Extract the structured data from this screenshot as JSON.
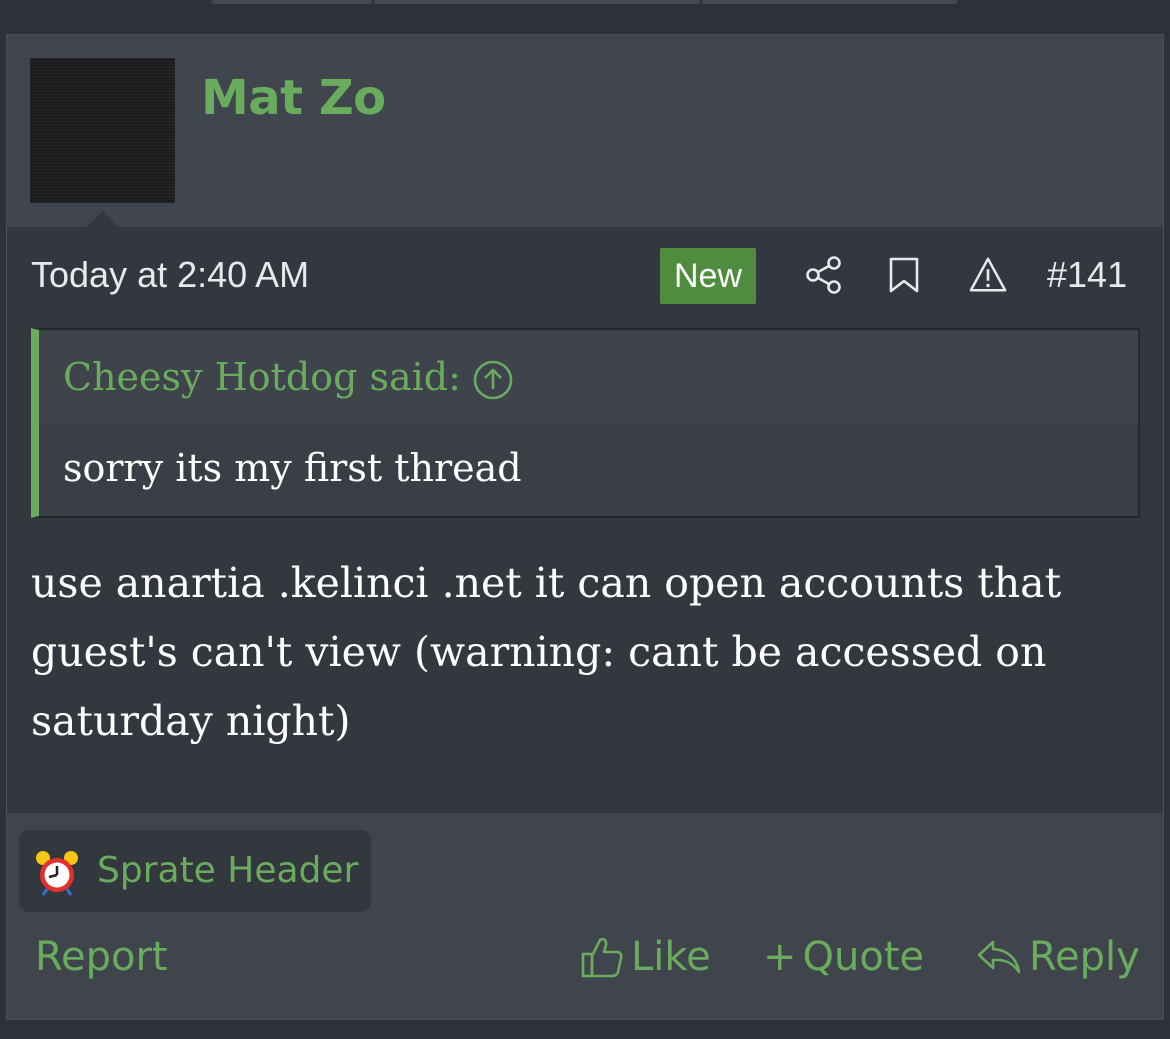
{
  "post": {
    "author": "Mat Zo",
    "timestamp": "Today at 2:40 AM",
    "badge": "New",
    "post_number": "#141",
    "icons": {
      "share": "share-icon",
      "bookmark": "bookmark-icon",
      "report": "warning-icon",
      "quote_jump": "arrow-up-circle-icon",
      "signature": "alarm-clock-icon",
      "like": "thumbs-up-icon",
      "reply": "reply-arrow-icon"
    },
    "quote": {
      "author_line": "Cheesy Hotdog said:",
      "text": "sorry its my first thread"
    },
    "message_lines": [
      "use anartia .kelinci .net it can open accounts that",
      "guest's can't view (warning: cant be accessed on",
      "saturday night)"
    ],
    "signature": "Sprate Header",
    "actions": {
      "report": "Report",
      "like": "Like",
      "quote_plus": "+",
      "quote": "Quote",
      "reply": "Reply"
    }
  },
  "colors": {
    "accent": "#6aac5e",
    "badge_bg": "#4f8c3e",
    "page_bg": "#2e3238",
    "post_bg": "#33373e",
    "header_bg": "#41454d"
  }
}
